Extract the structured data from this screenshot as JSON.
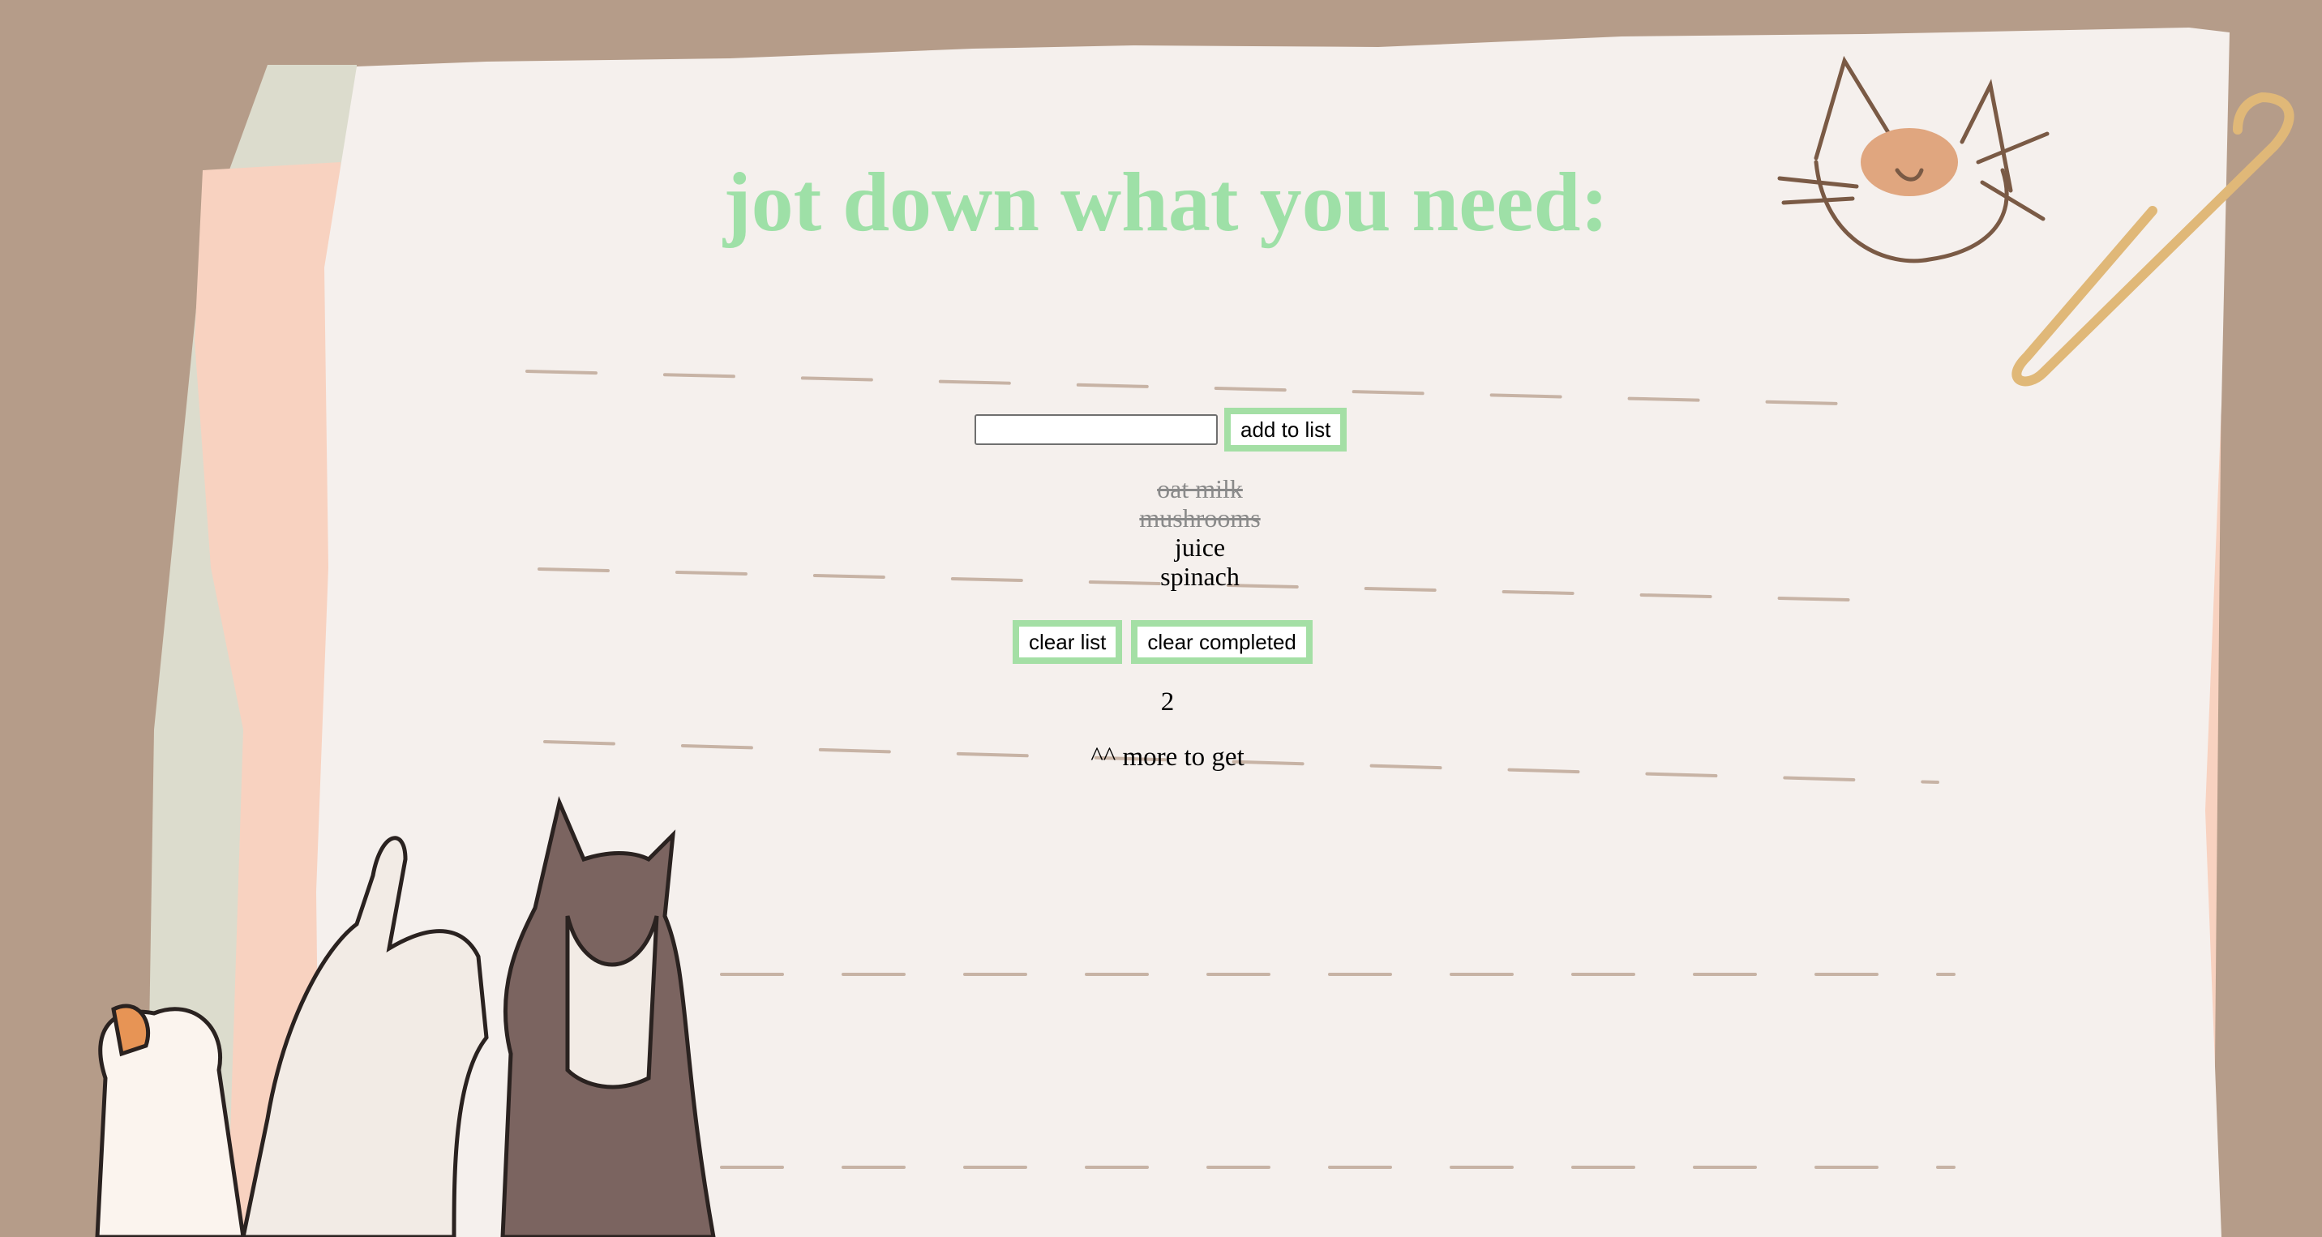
{
  "header": {
    "title": "jot down what you need:"
  },
  "form": {
    "input_value": "",
    "input_placeholder": "",
    "add_label": "add to list"
  },
  "items": [
    {
      "label": "oat milk",
      "completed": true
    },
    {
      "label": "mushrooms",
      "completed": true
    },
    {
      "label": "juice",
      "completed": false
    },
    {
      "label": "spinach",
      "completed": false
    }
  ],
  "actions": {
    "clear_list_label": "clear list",
    "clear_completed_label": "clear completed"
  },
  "status": {
    "remaining_count": "2",
    "remaining_text": "^^ more to get"
  },
  "colors": {
    "accent": "#a4dfa5",
    "title": "#9ee0a7",
    "background": "#b59c89",
    "paper": "#f5f0ed"
  },
  "decorations": [
    "cat-head-doodle",
    "paperclip",
    "cats-illustration"
  ]
}
